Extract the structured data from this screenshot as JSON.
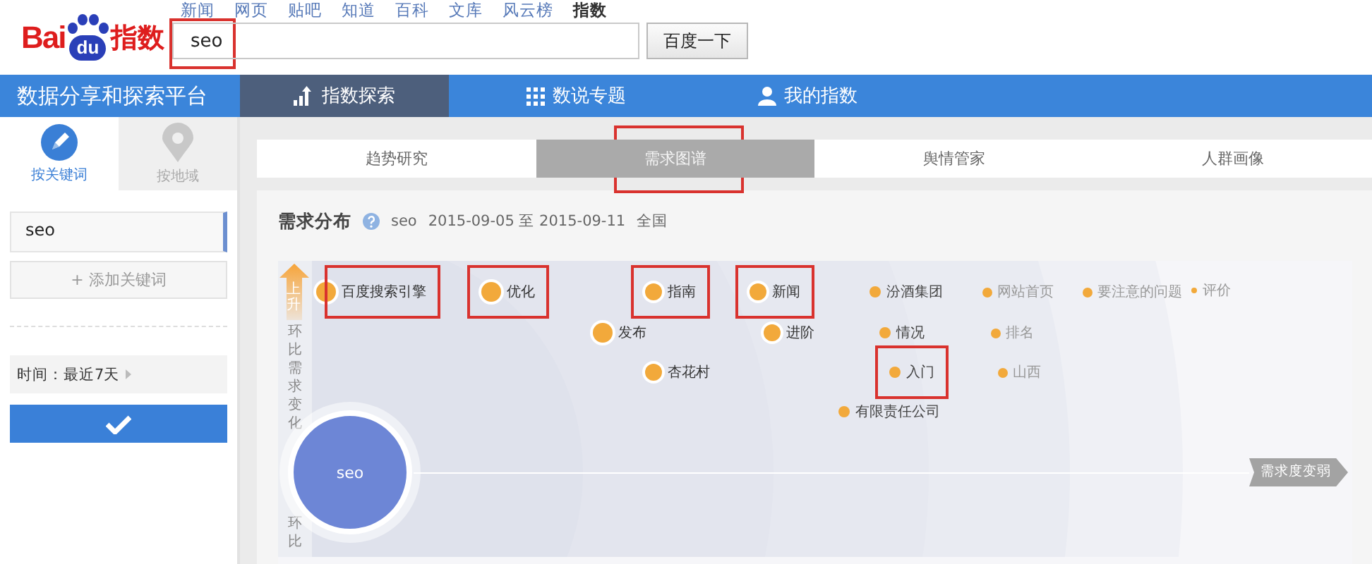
{
  "top_links": [
    {
      "label": "新闻",
      "selected": false
    },
    {
      "label": "网页",
      "selected": false
    },
    {
      "label": "贴吧",
      "selected": false
    },
    {
      "label": "知道",
      "selected": false
    },
    {
      "label": "百科",
      "selected": false
    },
    {
      "label": "文库",
      "selected": false
    },
    {
      "label": "风云榜",
      "selected": false
    },
    {
      "label": "指数",
      "selected": true
    }
  ],
  "logo": {
    "brand": "Bai",
    "paw": "du",
    "product": "指数"
  },
  "search": {
    "value": "seo",
    "highlighted": true,
    "button": "百度一下"
  },
  "nav": {
    "title": "数据分享和探索平台",
    "items": [
      {
        "label": "指数探索",
        "selected": true
      },
      {
        "label": "数说专题",
        "selected": false
      },
      {
        "label": "我的指数",
        "selected": false
      }
    ]
  },
  "sidebar": {
    "modes": [
      {
        "label": "按关键词",
        "selected": true
      },
      {
        "label": "按地域",
        "selected": false
      }
    ],
    "keyword": "seo",
    "add_button": "+ 添加关键词",
    "time": "时间：最近7天"
  },
  "tabs": [
    {
      "label": "趋势研究",
      "selected": false,
      "highlighted": false
    },
    {
      "label": "需求图谱",
      "selected": true,
      "highlighted": true
    },
    {
      "label": "舆情管家",
      "selected": false,
      "highlighted": false
    },
    {
      "label": "人群画像",
      "selected": false,
      "highlighted": false
    }
  ],
  "panel": {
    "title": "需求分布",
    "keyword": "seo",
    "date_range": "2015-09-05 至 2015-09-11",
    "region": "全国"
  },
  "chart": {
    "center": "seo",
    "rise_label": "上升",
    "axis_label": "环比需求变化",
    "axis_label_bottom": "环比",
    "right_label": "需求度变弱",
    "terms": [
      {
        "name": "百度搜索引擎",
        "kind": "large",
        "highlighted": true
      },
      {
        "name": "优化",
        "kind": "large",
        "highlighted": true
      },
      {
        "name": "指南",
        "kind": "medium",
        "highlighted": true
      },
      {
        "name": "新闻",
        "kind": "medium",
        "highlighted": true
      },
      {
        "name": "汾酒集团",
        "kind": "small",
        "highlighted": false
      },
      {
        "name": "网站首页",
        "kind": "tiny",
        "highlighted": false
      },
      {
        "name": "要注意的问题",
        "kind": "tiny",
        "highlighted": false
      },
      {
        "name": "评价",
        "kind": "dot",
        "highlighted": false
      },
      {
        "name": "发布",
        "kind": "large",
        "highlighted": false
      },
      {
        "name": "进阶",
        "kind": "medium",
        "highlighted": false
      },
      {
        "name": "情况",
        "kind": "small",
        "highlighted": false
      },
      {
        "name": "排名",
        "kind": "tiny",
        "highlighted": false
      },
      {
        "name": "杏花村",
        "kind": "medium",
        "highlighted": false
      },
      {
        "name": "入门",
        "kind": "small",
        "highlighted": true
      },
      {
        "name": "山西",
        "kind": "tiny",
        "highlighted": false
      },
      {
        "name": "有限责任公司",
        "kind": "small",
        "highlighted": false
      }
    ]
  }
}
